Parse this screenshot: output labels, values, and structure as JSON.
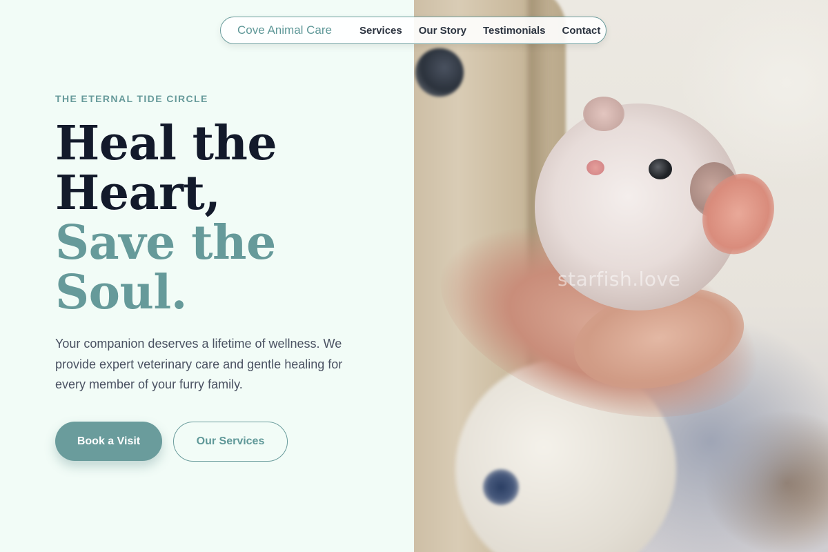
{
  "nav": {
    "brand": "Cove Animal Care",
    "links": [
      "Services",
      "Our Story",
      "Testimonials",
      "Contact"
    ]
  },
  "hero": {
    "eyebrow": "THE ETERNAL TIDE CIRCLE",
    "headline_line1": "Heal the",
    "headline_line2": "Heart,",
    "headline_line3": "Save the",
    "headline_line4": "Soul.",
    "description": "Your companion deserves a lifetime of wellness. We provide expert veterinary care and gentle healing for every member of your furry family.",
    "primary_button": "Book a Visit",
    "secondary_button": "Our Services"
  },
  "photo": {
    "subject": "hamster held in a hand",
    "watermark": "starfish.love"
  },
  "colors": {
    "accent": "#6a9c9c",
    "heading": "#131a2b",
    "body_text": "#4a5262",
    "panel_background": "#f2fcf7"
  }
}
